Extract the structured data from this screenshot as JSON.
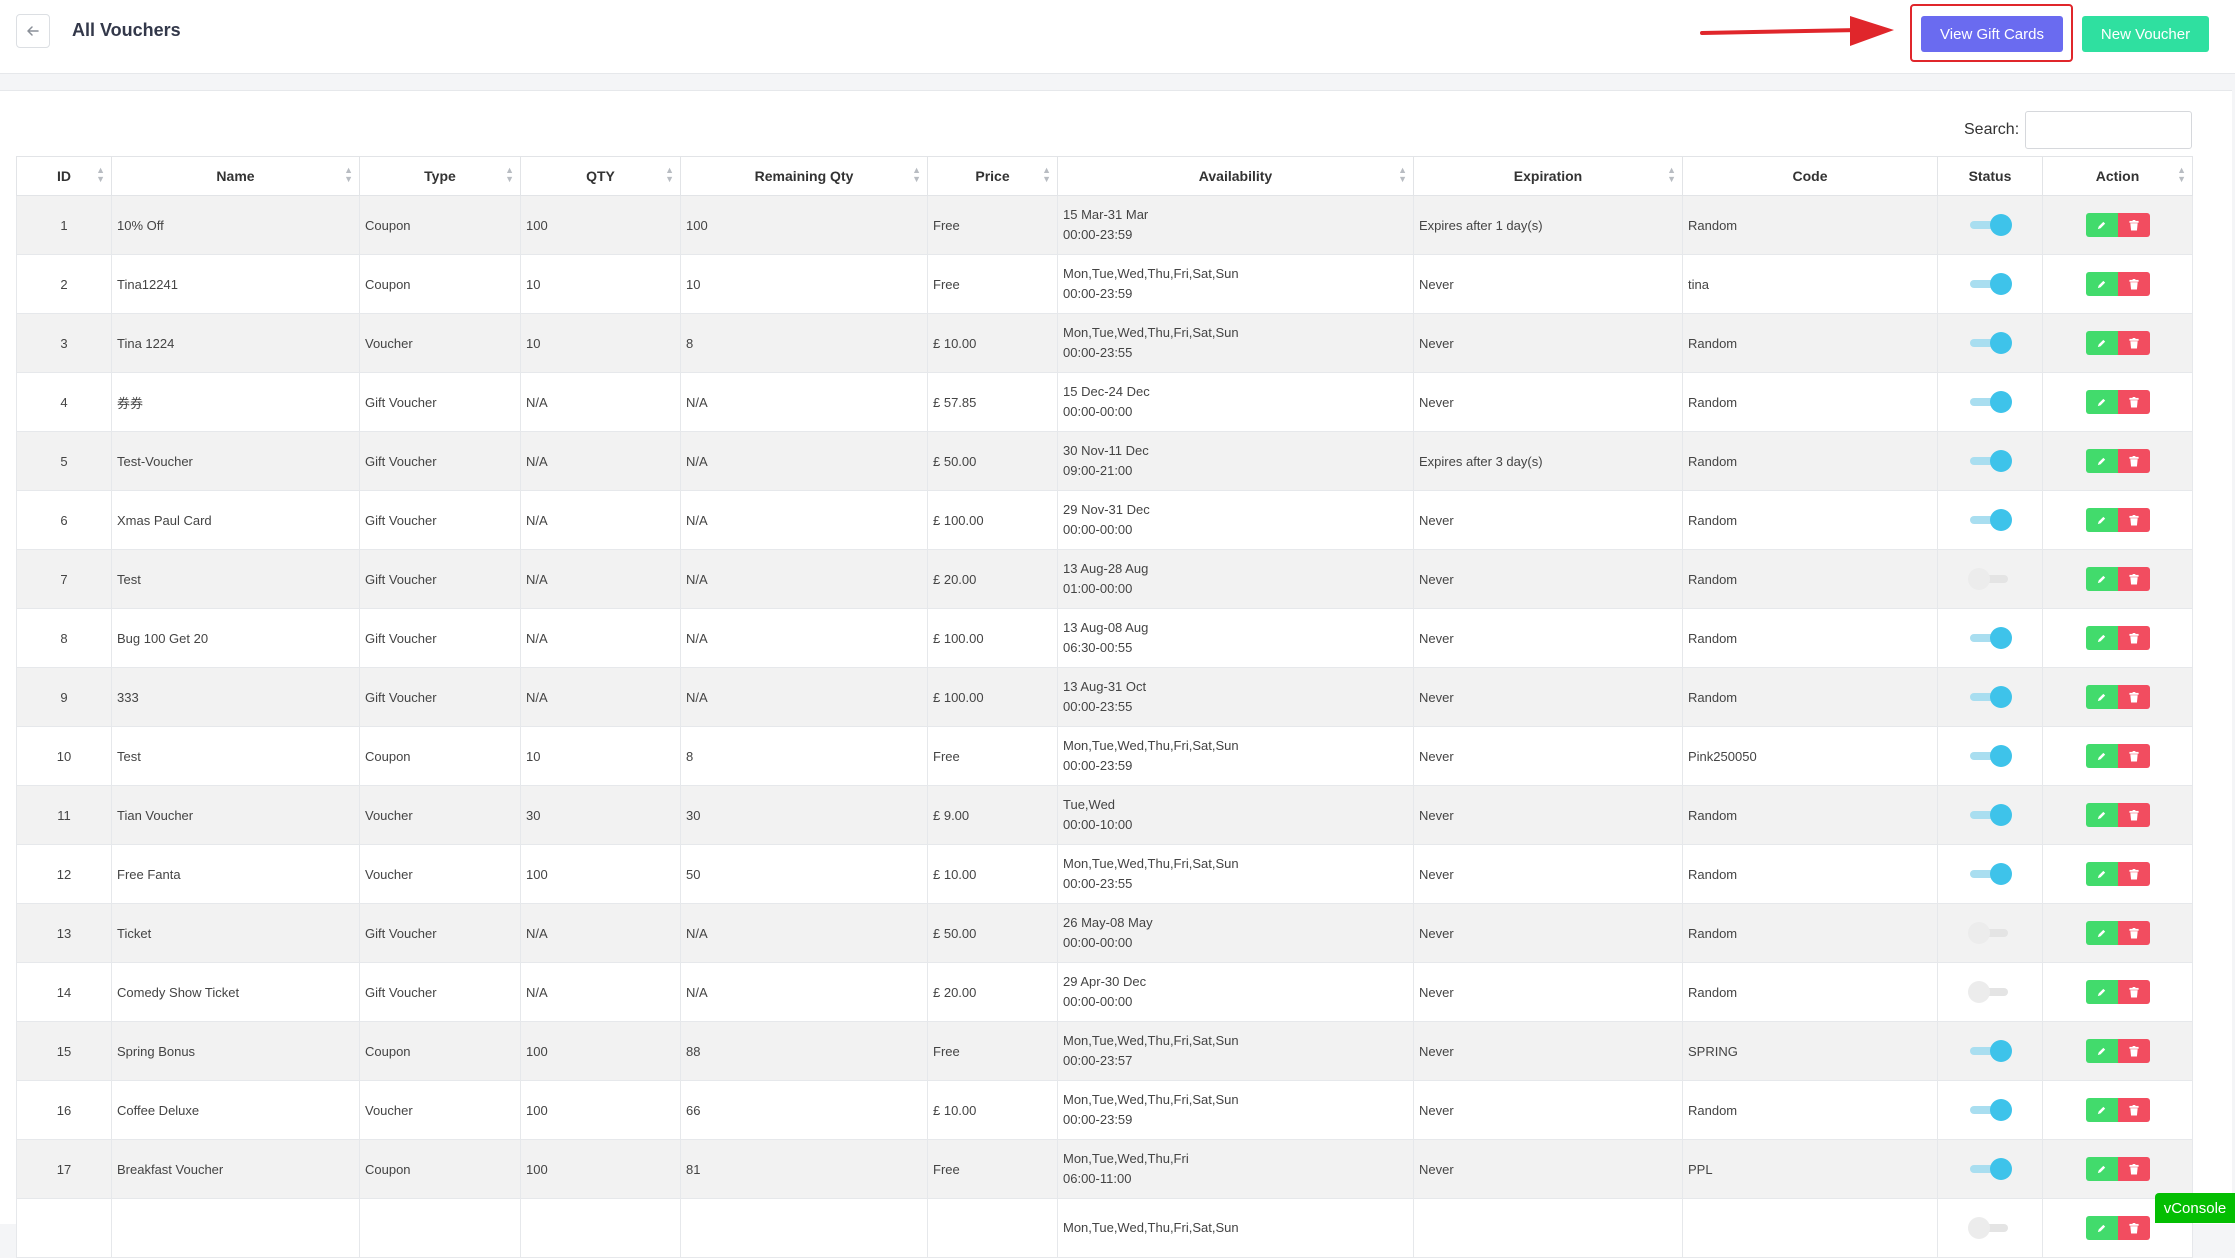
{
  "header": {
    "title": "All Vouchers",
    "view_gift_cards_label": "View Gift Cards",
    "new_voucher_label": "New Voucher"
  },
  "search": {
    "label": "Search:",
    "value": ""
  },
  "table": {
    "columns": [
      "ID",
      "Name",
      "Type",
      "QTY",
      "Remaining Qty",
      "Price",
      "Availability",
      "Expiration",
      "Code",
      "Status",
      "Action"
    ],
    "rows": [
      {
        "id": "1",
        "name": "10% Off",
        "type": "Coupon",
        "qty": "100",
        "remaining": "100",
        "price": "Free",
        "avail_days": "15 Mar-31 Mar",
        "avail_time": "00:00-23:59",
        "expiration": "Expires after 1 day(s)",
        "code": "Random",
        "status_on": true
      },
      {
        "id": "2",
        "name": "Tina12241",
        "type": "Coupon",
        "qty": "10",
        "remaining": "10",
        "price": "Free",
        "avail_days": "Mon,Tue,Wed,Thu,Fri,Sat,Sun",
        "avail_time": "00:00-23:59",
        "expiration": "Never",
        "code": "tina",
        "status_on": true
      },
      {
        "id": "3",
        "name": "Tina 1224",
        "type": "Voucher",
        "qty": "10",
        "remaining": "8",
        "price": "£ 10.00",
        "avail_days": "Mon,Tue,Wed,Thu,Fri,Sat,Sun",
        "avail_time": "00:00-23:55",
        "expiration": "Never",
        "code": "Random",
        "status_on": true
      },
      {
        "id": "4",
        "name": "券券",
        "type": "Gift Voucher",
        "qty": "N/A",
        "remaining": "N/A",
        "price": "£ 57.85",
        "avail_days": "15 Dec-24 Dec",
        "avail_time": "00:00-00:00",
        "expiration": "Never",
        "code": "Random",
        "status_on": true
      },
      {
        "id": "5",
        "name": "Test-Voucher",
        "type": "Gift Voucher",
        "qty": "N/A",
        "remaining": "N/A",
        "price": "£ 50.00",
        "avail_days": "30 Nov-11 Dec",
        "avail_time": "09:00-21:00",
        "expiration": "Expires after 3 day(s)",
        "code": "Random",
        "status_on": true
      },
      {
        "id": "6",
        "name": "Xmas Paul Card",
        "type": "Gift Voucher",
        "qty": "N/A",
        "remaining": "N/A",
        "price": "£ 100.00",
        "avail_days": "29 Nov-31 Dec",
        "avail_time": "00:00-00:00",
        "expiration": "Never",
        "code": "Random",
        "status_on": true
      },
      {
        "id": "7",
        "name": "Test",
        "type": "Gift Voucher",
        "qty": "N/A",
        "remaining": "N/A",
        "price": "£ 20.00",
        "avail_days": "13 Aug-28 Aug",
        "avail_time": "01:00-00:00",
        "expiration": "Never",
        "code": "Random",
        "status_on": false
      },
      {
        "id": "8",
        "name": "Bug 100 Get 20",
        "type": "Gift Voucher",
        "qty": "N/A",
        "remaining": "N/A",
        "price": "£ 100.00",
        "avail_days": "13 Aug-08 Aug",
        "avail_time": "06:30-00:55",
        "expiration": "Never",
        "code": "Random",
        "status_on": true
      },
      {
        "id": "9",
        "name": "333",
        "type": "Gift Voucher",
        "qty": "N/A",
        "remaining": "N/A",
        "price": "£ 100.00",
        "avail_days": "13 Aug-31 Oct",
        "avail_time": "00:00-23:55",
        "expiration": "Never",
        "code": "Random",
        "status_on": true
      },
      {
        "id": "10",
        "name": "Test",
        "type": "Coupon",
        "qty": "10",
        "remaining": "8",
        "price": "Free",
        "avail_days": "Mon,Tue,Wed,Thu,Fri,Sat,Sun",
        "avail_time": "00:00-23:59",
        "expiration": "Never",
        "code": "Pink250050",
        "status_on": true
      },
      {
        "id": "11",
        "name": "Tian Voucher",
        "type": "Voucher",
        "qty": "30",
        "remaining": "30",
        "price": "£ 9.00",
        "avail_days": "Tue,Wed",
        "avail_time": "00:00-10:00",
        "expiration": "Never",
        "code": "Random",
        "status_on": true
      },
      {
        "id": "12",
        "name": "Free Fanta",
        "type": "Voucher",
        "qty": "100",
        "remaining": "50",
        "price": "£ 10.00",
        "avail_days": "Mon,Tue,Wed,Thu,Fri,Sat,Sun",
        "avail_time": "00:00-23:55",
        "expiration": "Never",
        "code": "Random",
        "status_on": true
      },
      {
        "id": "13",
        "name": "Ticket",
        "type": "Gift Voucher",
        "qty": "N/A",
        "remaining": "N/A",
        "price": "£ 50.00",
        "avail_days": "26 May-08 May",
        "avail_time": "00:00-00:00",
        "expiration": "Never",
        "code": "Random",
        "status_on": false
      },
      {
        "id": "14",
        "name": "Comedy Show Ticket",
        "type": "Gift Voucher",
        "qty": "N/A",
        "remaining": "N/A",
        "price": "£ 20.00",
        "avail_days": "29 Apr-30 Dec",
        "avail_time": "00:00-00:00",
        "expiration": "Never",
        "code": "Random",
        "status_on": false
      },
      {
        "id": "15",
        "name": "Spring Bonus",
        "type": "Coupon",
        "qty": "100",
        "remaining": "88",
        "price": "Free",
        "avail_days": "Mon,Tue,Wed,Thu,Fri,Sat,Sun",
        "avail_time": "00:00-23:57",
        "expiration": "Never",
        "code": "SPRING",
        "status_on": true
      },
      {
        "id": "16",
        "name": "Coffee Deluxe",
        "type": "Voucher",
        "qty": "100",
        "remaining": "66",
        "price": "£ 10.00",
        "avail_days": "Mon,Tue,Wed,Thu,Fri,Sat,Sun",
        "avail_time": "00:00-23:59",
        "expiration": "Never",
        "code": "Random",
        "status_on": true
      },
      {
        "id": "17",
        "name": "Breakfast Voucher",
        "type": "Coupon",
        "qty": "100",
        "remaining": "81",
        "price": "Free",
        "avail_days": "Mon,Tue,Wed,Thu,Fri",
        "avail_time": "06:00-11:00",
        "expiration": "Never",
        "code": "PPL",
        "status_on": true
      },
      {
        "id": "",
        "name": "",
        "type": "",
        "qty": "",
        "remaining": "",
        "price": "",
        "avail_days": "Mon,Tue,Wed,Thu,Fri,Sat,Sun",
        "avail_time": "",
        "expiration": "",
        "code": "",
        "status_on": false
      }
    ]
  },
  "vconsole_label": "vConsole",
  "colors": {
    "view_gift_cards_bg": "#6a6bf0",
    "new_voucher_bg": "#2fe0a0",
    "annotation": "#e0262b",
    "toggle_on": "#3ec3ea",
    "edit_bg": "#42db6c",
    "delete_bg": "#f24d60",
    "vconsole_bg": "#04be02"
  },
  "icons": {
    "back": "arrow-left-icon",
    "sort": "sort-icon",
    "edit": "pencil-icon",
    "delete": "trash-icon"
  }
}
